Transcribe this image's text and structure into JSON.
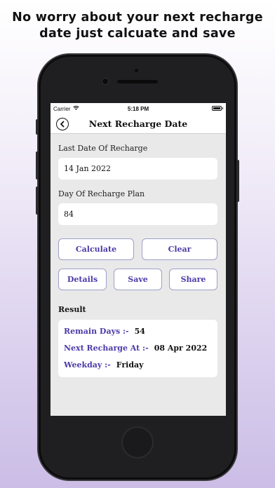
{
  "headline": {
    "line1": "No worry about your next recharge",
    "line2": "date just calcuate and save"
  },
  "status_bar": {
    "carrier": "Carrier",
    "time": "5:18 PM",
    "icons": [
      "wifi-icon",
      "battery-icon"
    ]
  },
  "navbar": {
    "title": "Next Recharge Date",
    "back_icon": "chevron-left-circle-icon"
  },
  "form": {
    "last_date_label": "Last Date Of Recharge",
    "last_date_value": "14 Jan 2022",
    "plan_days_label": "Day Of Recharge Plan",
    "plan_days_value": "84"
  },
  "actions": {
    "calculate": "Calculate",
    "clear": "Clear",
    "details": "Details",
    "save": "Save",
    "share": "Share"
  },
  "result": {
    "title": "Result",
    "remain_days_label": "Remain Days :-",
    "remain_days_value": "54",
    "next_recharge_label": "Next Recharge At :-",
    "next_recharge_value": "08 Apr 2022",
    "weekday_label": "Weekday :-",
    "weekday_value": "Friday"
  },
  "colors": {
    "accent": "#4b3aa8",
    "button_border": "#9ea0c8",
    "screen_background": "#e9e9e9",
    "device_body": "#1f1f21"
  }
}
